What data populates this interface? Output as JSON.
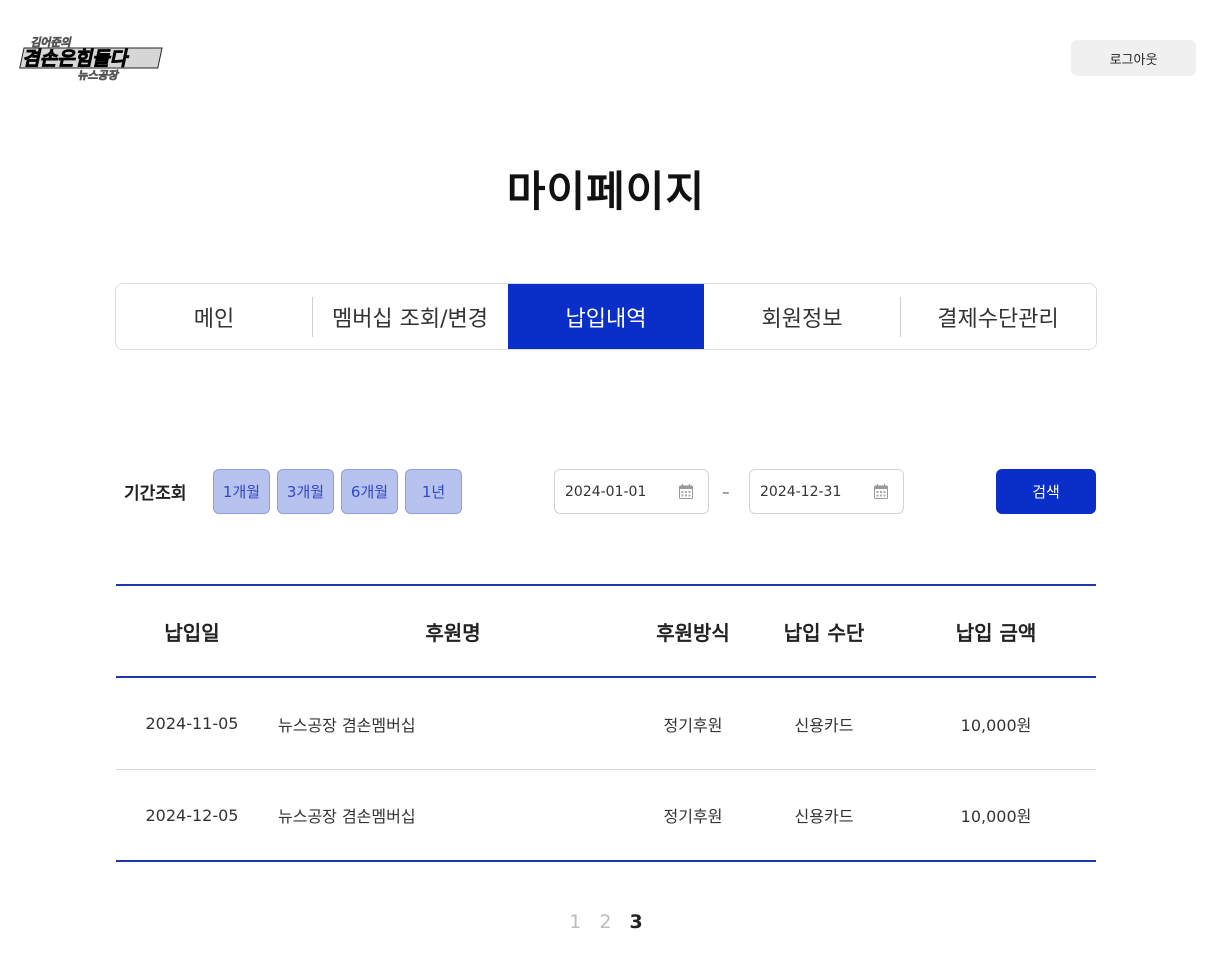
{
  "header": {
    "logout_label": "로그아웃"
  },
  "page": {
    "title": "마이페이지"
  },
  "tabs": [
    {
      "label": "메인"
    },
    {
      "label": "멤버십 조회/변경"
    },
    {
      "label": "납입내역"
    },
    {
      "label": "회원정보"
    },
    {
      "label": "결제수단관리"
    }
  ],
  "filter": {
    "label": "기간조회",
    "periods": [
      "1개월",
      "3개월",
      "6개월",
      "1년"
    ],
    "start_date": "2024-01-01",
    "end_date": "2024-12-31",
    "separator": "–",
    "search_label": "검색"
  },
  "table": {
    "headers": {
      "date": "납입일",
      "name": "후원명",
      "method": "후원방식",
      "pay": "납입 수단",
      "amount": "납입 금액"
    },
    "rows": [
      {
        "date": "2024-11-05",
        "name": "뉴스공장 겸손멤버십",
        "method": "정기후원",
        "pay": "신용카드",
        "amount": "10,000원"
      },
      {
        "date": "2024-12-05",
        "name": "뉴스공장 겸손멤버십",
        "method": "정기후원",
        "pay": "신용카드",
        "amount": "10,000원"
      }
    ]
  },
  "pagination": {
    "pages": [
      "1",
      "2",
      "3"
    ],
    "current": "3"
  },
  "colors": {
    "primary": "#0a2ec8",
    "period_bg": "#b8c2ef",
    "table_line": "#1d3aa8"
  },
  "icons": {
    "logo": "logo",
    "calendar": "calendar-icon"
  }
}
